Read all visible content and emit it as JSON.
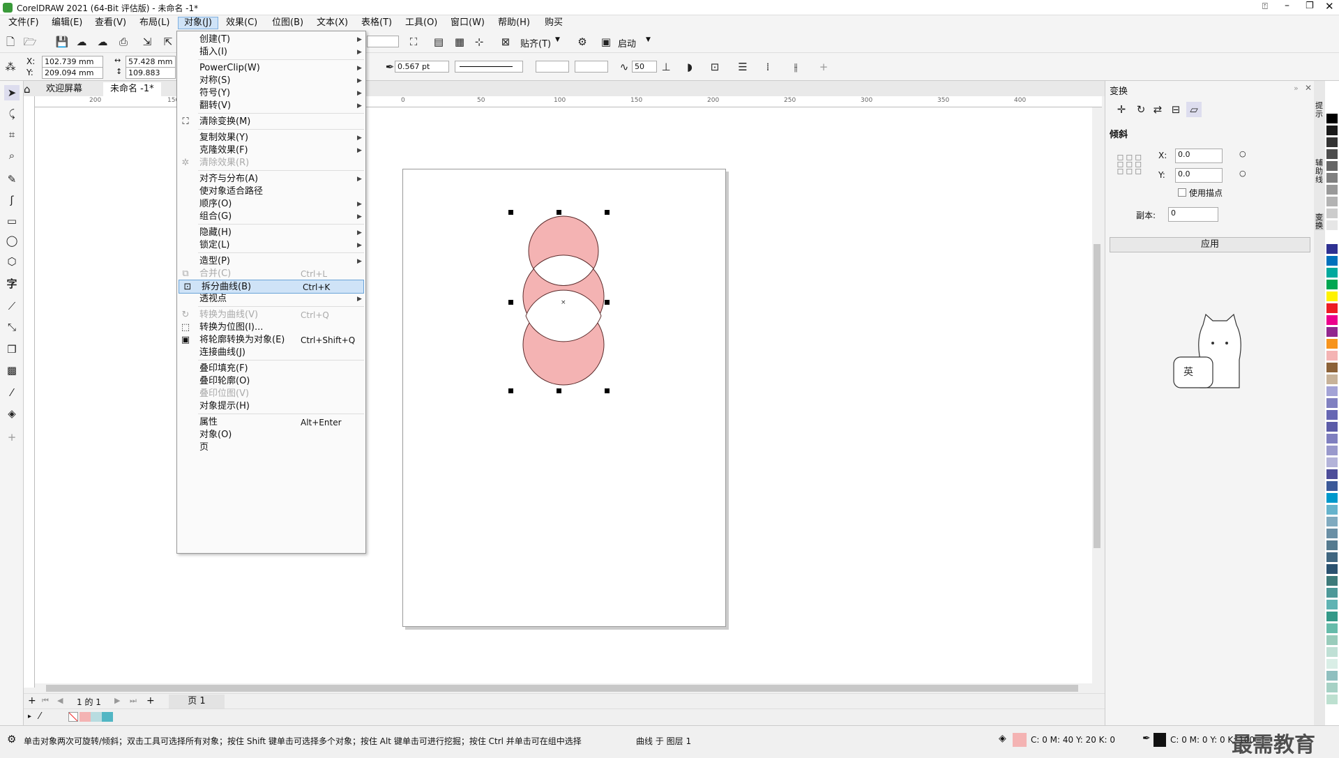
{
  "title": "CorelDRAW 2021 (64-Bit 评估版) - 未命名 -1*",
  "menubar": [
    "文件(F)",
    "编辑(E)",
    "查看(V)",
    "布局(L)",
    "对象(J)",
    "效果(C)",
    "位图(B)",
    "文本(X)",
    "表格(T)",
    "工具(O)",
    "窗口(W)",
    "帮助(H)",
    "购买"
  ],
  "toolbar": {
    "snap_label": "贴齐(T)",
    "launch_label": "启动"
  },
  "propbar": {
    "x_label": "X:",
    "y_label": "Y:",
    "x": "102.739 mm",
    "y": "209.094 mm",
    "w": "57.428 mm",
    "h": "109.883 mm",
    "outline": "0.567 pt",
    "smooth": "50"
  },
  "doctabs": {
    "welcome": "欢迎屏幕",
    "doc": "未命名 -1*"
  },
  "ruler": {
    "h": [
      "200",
      "150",
      "0",
      "50",
      "100",
      "150",
      "200",
      "250",
      "300",
      "350",
      "400"
    ]
  },
  "dropdown": [
    {
      "label": "创建(T)",
      "arrow": true
    },
    {
      "label": "插入(I)",
      "arrow": true
    },
    {
      "sep": true
    },
    {
      "label": "PowerClip(W)",
      "arrow": true
    },
    {
      "label": "对称(S)",
      "arrow": true
    },
    {
      "label": "符号(Y)",
      "arrow": true
    },
    {
      "label": "翻转(V)",
      "arrow": true
    },
    {
      "sep": true
    },
    {
      "label": "清除变换(M)",
      "icon": "clear-transform-icon"
    },
    {
      "sep": true
    },
    {
      "label": "复制效果(Y)",
      "arrow": true
    },
    {
      "label": "克隆效果(F)",
      "arrow": true
    },
    {
      "label": "清除效果(R)",
      "disabled": true,
      "icon": "clear-effect-icon"
    },
    {
      "sep": true
    },
    {
      "label": "对齐与分布(A)",
      "arrow": true
    },
    {
      "label": "使对象适合路径"
    },
    {
      "label": "顺序(O)",
      "arrow": true
    },
    {
      "label": "组合(G)",
      "arrow": true
    },
    {
      "sep": true
    },
    {
      "label": "隐藏(H)",
      "arrow": true
    },
    {
      "label": "锁定(L)",
      "arrow": true
    },
    {
      "sep": true
    },
    {
      "label": "造型(P)",
      "arrow": true
    },
    {
      "label": "合并(C)",
      "shortcut": "Ctrl+L",
      "disabled": true,
      "icon": "combine-icon"
    },
    {
      "label": "拆分曲线(B)",
      "shortcut": "Ctrl+K",
      "highlight": true,
      "icon": "break-apart-icon"
    },
    {
      "label": "透视点",
      "arrow": true
    },
    {
      "sep": true
    },
    {
      "label": "转换为曲线(V)",
      "shortcut": "Ctrl+Q",
      "disabled": true,
      "icon": "convert-curves-icon"
    },
    {
      "label": "转换为位图(I)...",
      "icon": "convert-bitmap-icon"
    },
    {
      "label": "将轮廓转换为对象(E)",
      "shortcut": "Ctrl+Shift+Q",
      "icon": "outline-object-icon"
    },
    {
      "label": "连接曲线(J)"
    },
    {
      "sep": true
    },
    {
      "label": "叠印填充(F)"
    },
    {
      "label": "叠印轮廓(O)"
    },
    {
      "label": "叠印位图(V)",
      "disabled": true
    },
    {
      "label": "对象提示(H)"
    },
    {
      "sep": true
    },
    {
      "label": "属性",
      "shortcut": "Alt+Enter"
    },
    {
      "label": "对象(O)"
    },
    {
      "label": "页"
    }
  ],
  "pagebar": {
    "count": "1 的 1",
    "page": "页 1"
  },
  "docker": {
    "title": "变换",
    "section": "倾斜",
    "x_label": "X:",
    "y_label": "Y:",
    "x": "0.0",
    "y": "0.0",
    "anchor": "使用描点",
    "copies_label": "副本:",
    "copies": "0",
    "apply": "应用",
    "cat_badge": "英"
  },
  "dockertabs": [
    "提示",
    "辅助线",
    "变换"
  ],
  "status": {
    "hint": "单击对象两次可旋转/倾斜；双击工具可选择所有对象；按住 Shift 键单击可选择多个对象；按住 Alt 键单击可进行挖掘；按住 Ctrl 并单击可在组中选择",
    "layer": "曲线 于 图层 1",
    "fill": "C: 0 M: 40 Y: 20 K: 0",
    "outline": "C: 0 M: 0 Y: 0 K: 100"
  },
  "watermark": "最需教育",
  "colors": {
    "fill": "#f4b3b3",
    "palette": [
      "#ffffff",
      "#000000",
      "#1a1a1a",
      "#333333",
      "#4d4d4d",
      "#666666",
      "#808080",
      "#999999",
      "#b3b3b3",
      "#cccccc",
      "#e6e6e6",
      "#ffffff",
      "#2e3192",
      "#0071bc",
      "#00a99d",
      "#00a651",
      "#fff200",
      "#ed1c24",
      "#ec008c",
      "#92278f",
      "#f7941d",
      "#f4b3b3",
      "#8c6239",
      "#c7b299",
      "#a3a3d6",
      "#8080c0",
      "#6666b3",
      "#5c5ca8",
      "#7f7fbf",
      "#9999cc",
      "#b3b3d9",
      "#4d4d99",
      "#3b5998",
      "#0099cc",
      "#66b3cc",
      "#80aabf",
      "#6a8fa5",
      "#557a8f",
      "#406680",
      "#2b5270",
      "#3d7a7a",
      "#4d9999",
      "#5fb3b3",
      "#339988",
      "#66bbaa",
      "#99ccbb",
      "#bfe0d5",
      "#d9eee6",
      "#8fbfbf",
      "#a6d1c5",
      "#bde0d0"
    ]
  }
}
